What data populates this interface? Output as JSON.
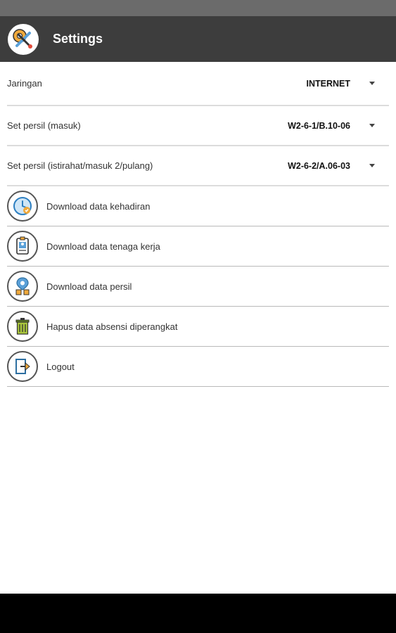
{
  "app_bar": {
    "title": "Settings",
    "logo_icon": "settings-tools-icon",
    "background": "#3d3d3d"
  },
  "settings": [
    {
      "label": "Jaringan",
      "value": "INTERNET"
    },
    {
      "label": "Set persil (masuk)",
      "value": "W2-6-1/B.10-06"
    },
    {
      "label": "Set persil (istirahat/masuk 2/pulang)",
      "value": "W2-6-2/A.06-03"
    }
  ],
  "actions": [
    {
      "label": "Download data kehadiran",
      "icon": "attendance-clock-icon"
    },
    {
      "label": "Download data tenaga kerja",
      "icon": "worker-id-icon"
    },
    {
      "label": "Download data persil",
      "icon": "location-pin-icon"
    },
    {
      "label": "Hapus data absensi diperangkat",
      "icon": "trash-icon"
    },
    {
      "label": "Logout",
      "icon": "logout-icon"
    }
  ]
}
